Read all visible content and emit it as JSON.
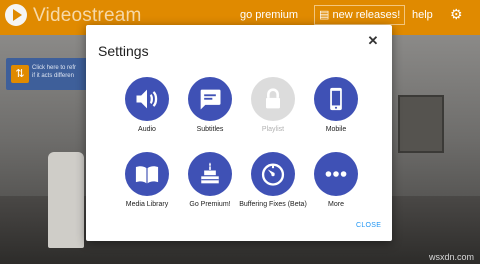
{
  "app": {
    "name": "Videostream",
    "nav_premium": "go premium",
    "nav_releases": "new releases!",
    "nav_help": "help"
  },
  "banner": {
    "line1": "Click here to refr",
    "line2": "if it acts differen"
  },
  "watermark": "wsxdn.com",
  "settings": {
    "title": "Settings",
    "close_label": "CLOSE",
    "items": [
      {
        "label": "Audio",
        "icon": "speaker-icon",
        "enabled": true
      },
      {
        "label": "Subtitles",
        "icon": "subtitles-icon",
        "enabled": true
      },
      {
        "label": "Playlist",
        "icon": "lock-icon",
        "enabled": false
      },
      {
        "label": "Mobile",
        "icon": "phone-icon",
        "enabled": true
      },
      {
        "label": "Media Library",
        "icon": "book-icon",
        "enabled": true
      },
      {
        "label": "Go Premium!",
        "icon": "cake-icon",
        "enabled": true
      },
      {
        "label": "Buffering Fixes (Beta)",
        "icon": "timer-icon",
        "enabled": true
      },
      {
        "label": "More",
        "icon": "more-dots-icon",
        "enabled": true
      }
    ]
  },
  "colors": {
    "brand_orange": "#e08a00",
    "icon_blue": "#3f51b5",
    "disabled_gray": "#dcdcdc",
    "link_blue": "#2196f3"
  }
}
